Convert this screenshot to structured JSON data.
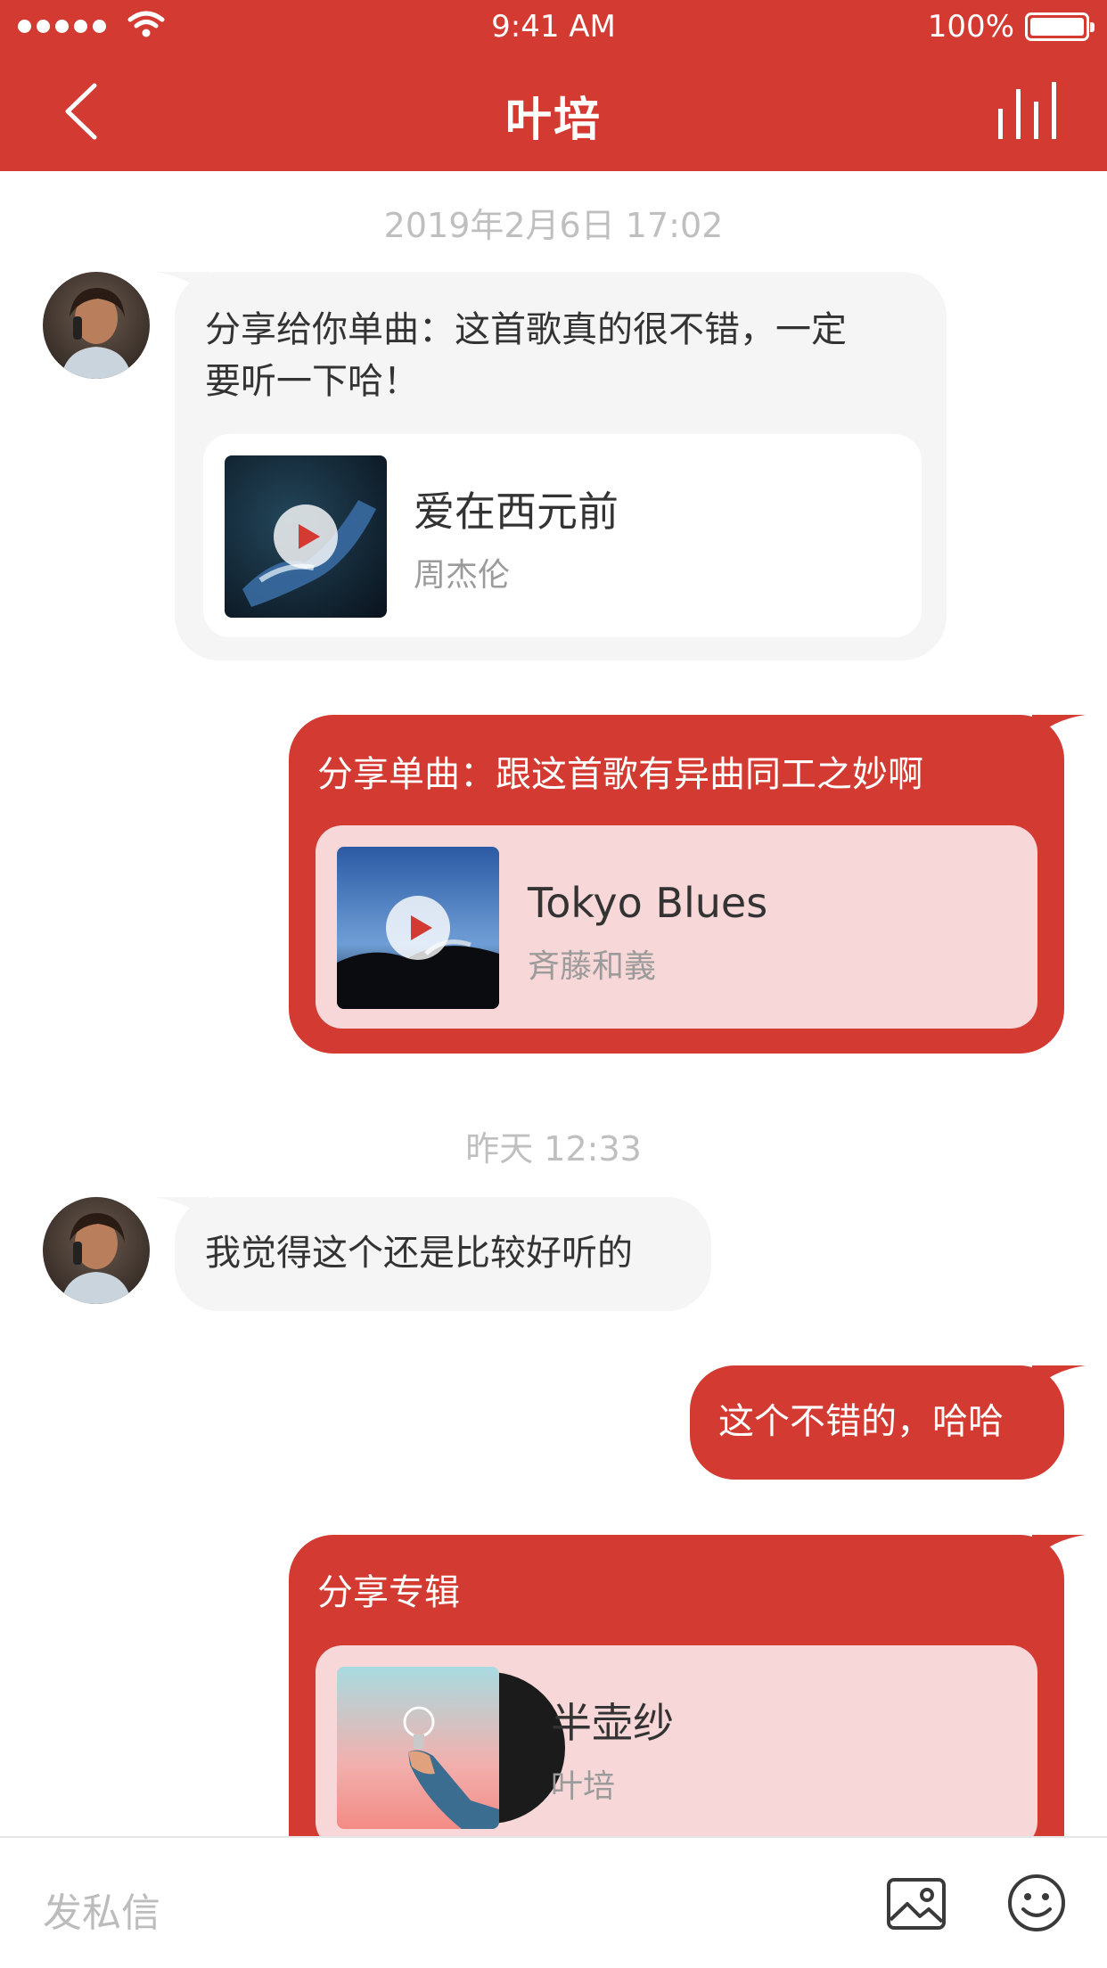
{
  "status_bar": {
    "time": "9:41 AM",
    "battery": "100%"
  },
  "header": {
    "title": "叶培"
  },
  "messages": {
    "ts1": "2019年2月6日 17:02",
    "m1_line1": "分享给你单曲：这首歌真的很不错，一定",
    "m1_line2": "要听一下哈！",
    "m1_song_title": "爱在西元前",
    "m1_song_artist": "周杰伦",
    "m2_text": "分享单曲：跟这首歌有异曲同工之妙啊",
    "m2_song_title": "Tokyo Blues",
    "m2_song_artist": "斉藤和義",
    "ts2": "昨天 12:33",
    "m3_text": "我觉得这个还是比较好听的",
    "m4_text": "这个不错的，哈哈",
    "m5_text": "分享专辑",
    "m5_album_title": "半壶纱",
    "m5_album_artist": "叶培"
  },
  "input": {
    "placeholder": "发私信"
  },
  "icons": [
    "back-icon",
    "equalizer-icon",
    "image-icon",
    "emoji-icon",
    "play-icon"
  ],
  "colors": {
    "accent": "#d33a31",
    "card_out": "#f7d7d7",
    "bubble_in": "#f5f5f5"
  }
}
